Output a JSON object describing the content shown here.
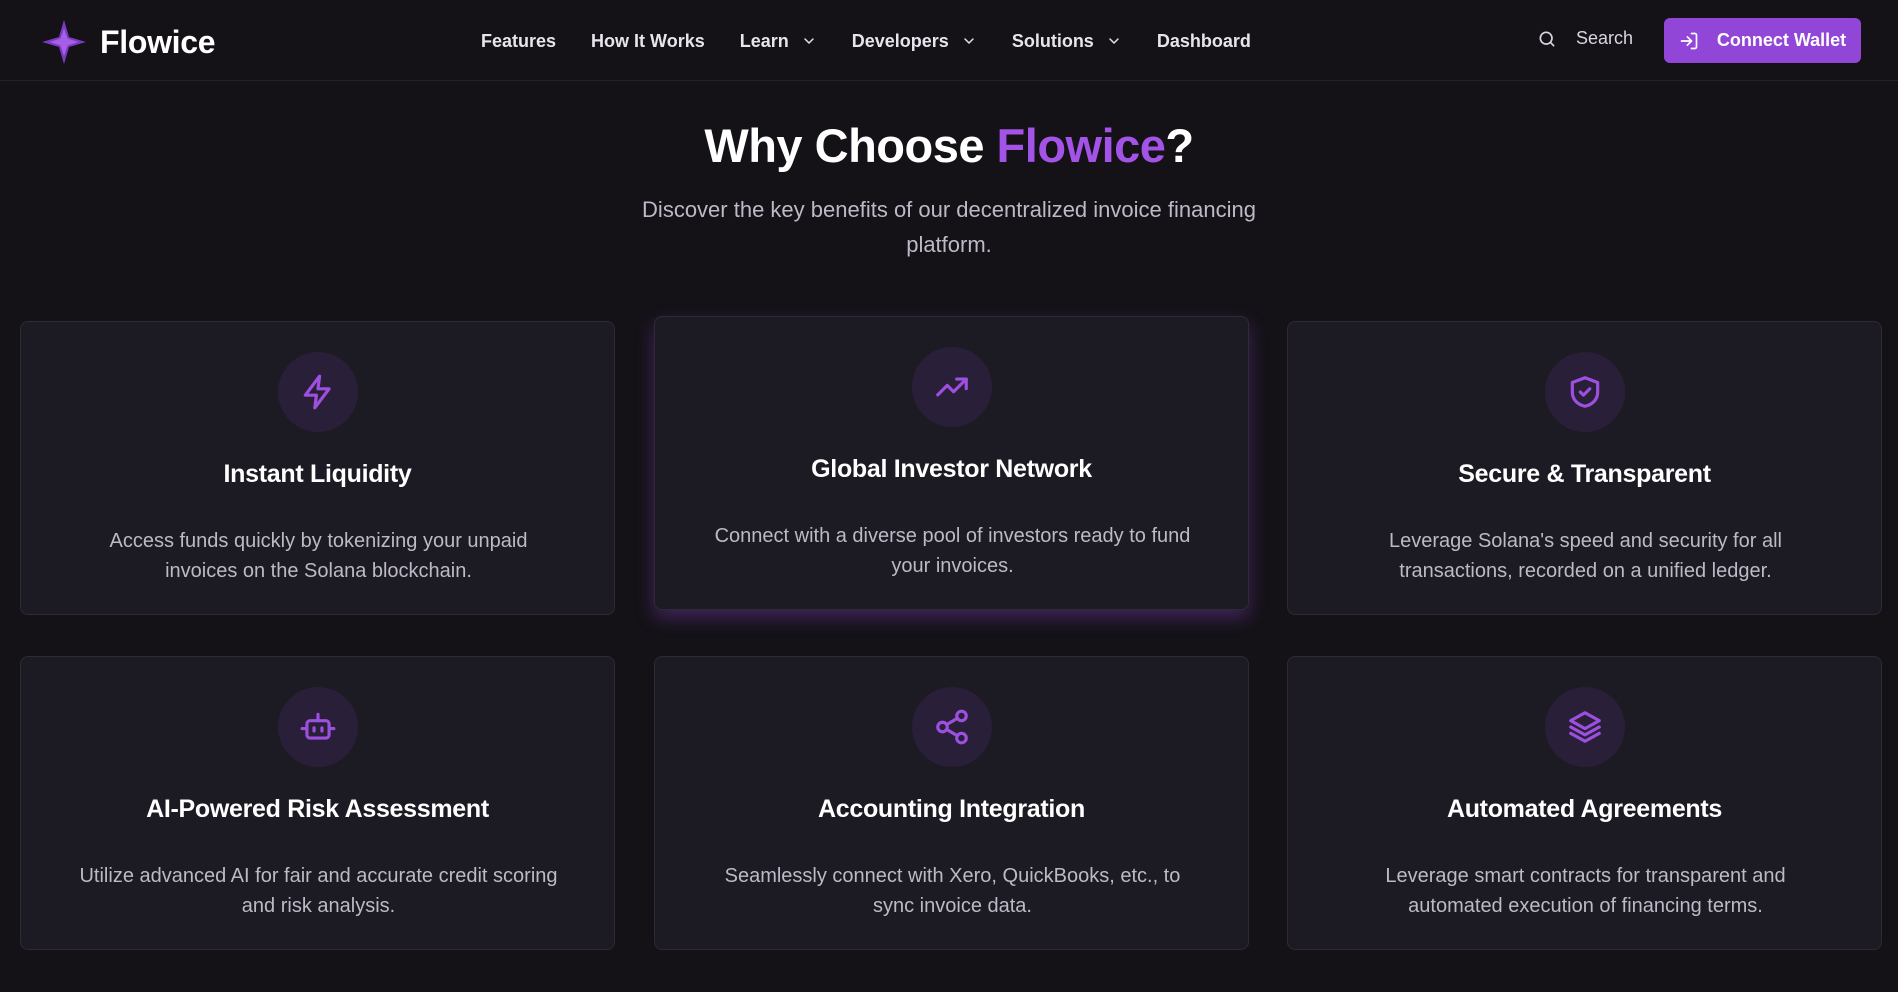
{
  "brand": {
    "name": "Flowice",
    "logo_icon": "four-point-star-logo",
    "accent_color": "#9146d7"
  },
  "nav": {
    "items": [
      {
        "label": "Features",
        "has_dropdown": false
      },
      {
        "label": "How It Works",
        "has_dropdown": false
      },
      {
        "label": "Learn",
        "has_dropdown": true
      },
      {
        "label": "Developers",
        "has_dropdown": true
      },
      {
        "label": "Solutions",
        "has_dropdown": true
      },
      {
        "label": "Dashboard",
        "has_dropdown": false
      }
    ],
    "search_label": "Search",
    "connect_wallet_label": "Connect Wallet"
  },
  "hero": {
    "title_prefix": "Why Choose ",
    "title_accent": "Flowice",
    "title_suffix": "?",
    "subtitle": "Discover the key benefits of our decentralized invoice financing platform."
  },
  "features": [
    {
      "icon": "lightning-icon",
      "title": "Instant Liquidity",
      "description": "Access funds quickly by tokenizing your unpaid invoices on the Solana blockchain."
    },
    {
      "icon": "trending-up-icon",
      "title": "Global Investor Network",
      "description": "Connect with a diverse pool of investors ready to fund your invoices."
    },
    {
      "icon": "shield-check-icon",
      "title": "Secure & Transparent",
      "description": "Leverage Solana's speed and security for all transactions, recorded on a unified ledger."
    },
    {
      "icon": "bot-icon",
      "title": "AI-Powered Risk Assessment",
      "description": "Utilize advanced AI for fair and accurate credit scoring and risk analysis."
    },
    {
      "icon": "share-icon",
      "title": "Accounting Integration",
      "description": "Seamlessly connect with Xero, QuickBooks, etc., to sync invoice data."
    },
    {
      "icon": "layers-icon",
      "title": "Automated Agreements",
      "description": "Leverage smart contracts for transparent and automated execution of financing terms."
    }
  ]
}
